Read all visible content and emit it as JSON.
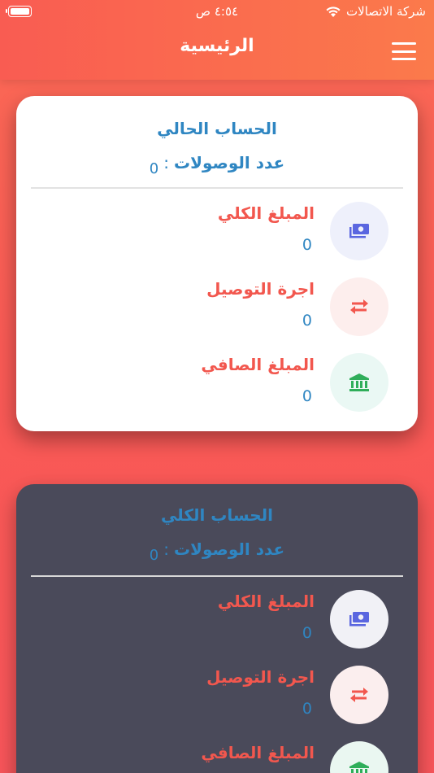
{
  "status": {
    "carrier": "شركة الاتصالات",
    "time": "٤:٥٤ ص"
  },
  "header": {
    "title": "الرئيسية"
  },
  "current_account": {
    "title": "الحساب الحالي",
    "count_label": "عدد الوصولات",
    "count_sep": ":",
    "count_value": "0",
    "rows": [
      {
        "label": "المبلغ الكلي",
        "value": "0",
        "icon": "money-icon"
      },
      {
        "label": "اجرة التوصيل",
        "value": "0",
        "icon": "transfer-arrows-icon"
      },
      {
        "label": "المبلغ الصافي",
        "value": "0",
        "icon": "bank-icon"
      }
    ]
  },
  "total_account": {
    "title": "الحساب الكلي",
    "count_label": "عدد الوصولات",
    "count_sep": ":",
    "count_value": "0",
    "rows": [
      {
        "label": "المبلغ الكلي",
        "value": "0",
        "icon": "money-icon"
      },
      {
        "label": "اجرة التوصيل",
        "value": "0",
        "icon": "transfer-arrows-icon"
      },
      {
        "label": "المبلغ الصافي",
        "value": "",
        "icon": "bank-icon"
      }
    ]
  },
  "colors": {
    "header_start": "#f95c52",
    "header_end": "#fb7a4b",
    "title_blue": "#2f86c2",
    "label_red": "#f2574e",
    "dark_card": "#4a4a5a",
    "icon_blue": "#5a66e0",
    "icon_red": "#f2574e",
    "icon_green": "#2fae5a"
  }
}
